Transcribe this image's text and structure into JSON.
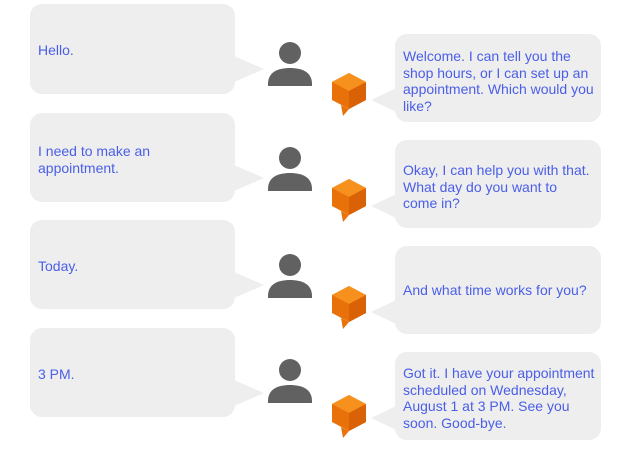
{
  "colors": {
    "text": "#4a5ee8",
    "bubble": "#eeeeee",
    "person_icon": "#616161",
    "bot_light": "#f6911e",
    "bot_dark": "#e8710a"
  },
  "icons": {
    "user": "person-icon",
    "agent": "dialogflow-agent-icon"
  },
  "conversation": [
    {
      "user": "Hello.",
      "agent": "Welcome. I can tell you the shop hours, or I can set up an appointment. Which would you like?"
    },
    {
      "user": "I need to make an appointment.",
      "agent": "Okay, I can help you with that. What day do you want to come in?"
    },
    {
      "user": "Today.",
      "agent": "And what time works for you?"
    },
    {
      "user": "3 PM.",
      "agent": "Got it. I have your appointment scheduled on Wednesday, August 1 at 3 PM. See you soon. Good-bye."
    }
  ]
}
